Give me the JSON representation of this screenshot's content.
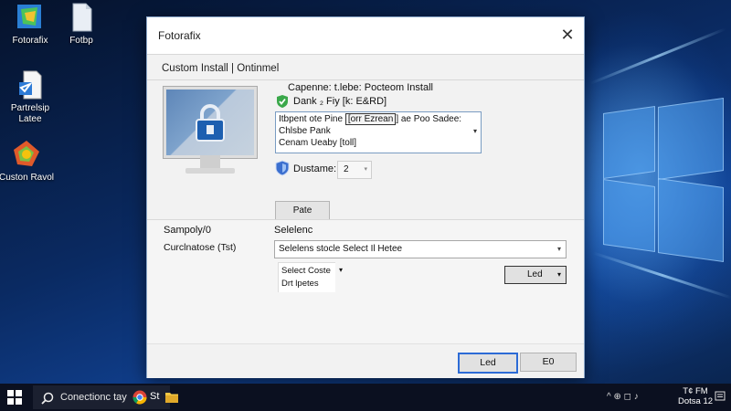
{
  "desktop": {
    "icons": [
      {
        "label": "Fotorafix",
        "icon": "fotorafix-app-icon"
      },
      {
        "label": "Fotbp",
        "icon": "document-file-icon"
      },
      {
        "label": "Partrelsip Latee",
        "icon": "setup-document-icon"
      },
      {
        "label": "Custon Ravol",
        "icon": "colorful-app-icon"
      }
    ]
  },
  "window": {
    "title": "Fotorafix",
    "close_glyph": "✕",
    "section_heading": "Custom Install  |  Ontinmel",
    "capture_label": "Capenne: t.lebe: Pocteom Install",
    "check_label": "Dank ₂ Fiy  [k: E&RD]",
    "listbox": {
      "row1_pre": "Itbpent ote Pine ",
      "row1_sel": "[orr Ezrean",
      "row1_post": "] ae Poo Sadee:",
      "row2": "Chlsbe Pank",
      "row3": "Cenam Ueaby [toll]",
      "arrow": "▾"
    },
    "spin_label": "Dustame:",
    "spin_value": "2",
    "spin_arrow": "▾",
    "pate_button": "Pate",
    "lower": {
      "left_label1": "Sampoly/0",
      "left_label2": "Curclnatose (Tst)",
      "selection_label": "Selelenc",
      "combo_value": "Selelens stocle  Select Il Hetee",
      "combo_arrow": "▾",
      "small_line1": "Select Coste",
      "small_line2": "Drt lpetes",
      "small_arrow": "▾",
      "dropdown_button": "Led",
      "dropdown_arrow": "▾"
    },
    "footer": {
      "primary_button": "Led",
      "secondary_button": "E0"
    }
  },
  "taskbar": {
    "search_text": "Conectionc tay",
    "app_label": "St",
    "tray_glyphs": "^  ⊕  ◻  ♪",
    "clock_line1": "T¢ FM",
    "clock_line2": "Dotsa 12"
  },
  "colors": {
    "accent_blue": "#2c6bd6",
    "check_green": "#3aa84a",
    "shield_blue": "#3b6fcf",
    "window_bg": "#f2f2f2",
    "taskbar_bg": "#0b1020"
  }
}
